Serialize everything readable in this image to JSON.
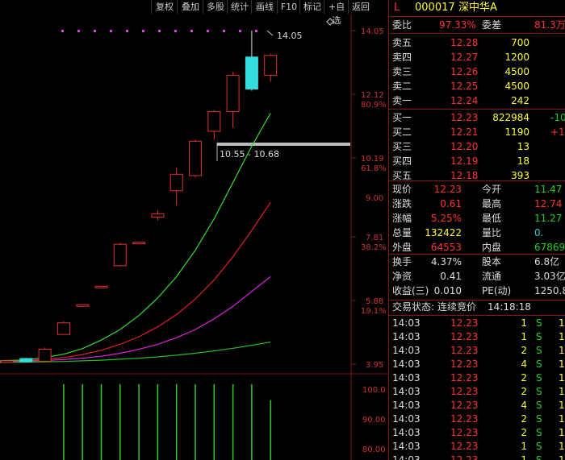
{
  "toolbar": {
    "buttons": [
      "复权",
      "叠加",
      "多股",
      "统计",
      "画线",
      "F10",
      "标记",
      "+自选",
      "返回"
    ]
  },
  "chart": {
    "price_axis": [
      "14.05",
      "12.12",
      "10.19",
      "9.00",
      "7.81",
      "5.88",
      "3.95"
    ],
    "pct_axis": [
      "80.9%",
      "61.8%",
      "38.2%",
      "19.1%"
    ],
    "vol_axis": [
      "100.0",
      "90.00",
      "80.00"
    ],
    "high_marker": "14.05",
    "range_label": "10.55 - 10.68"
  },
  "panel": {
    "code_prefix": "L",
    "stock_code": "000017",
    "stock_name": "深中华A",
    "weibi_label": "委比",
    "weibi_value": "97.33%",
    "weicha_label": "委差",
    "weicha_value": "81.3万",
    "asks": [
      {
        "label": "卖五",
        "price": "12.28",
        "vol": "700"
      },
      {
        "label": "卖四",
        "price": "12.27",
        "vol": "1200"
      },
      {
        "label": "卖三",
        "price": "12.26",
        "vol": "4500"
      },
      {
        "label": "卖二",
        "price": "12.25",
        "vol": "4500"
      },
      {
        "label": "卖一",
        "price": "12.24",
        "vol": "242"
      }
    ],
    "bids": [
      {
        "label": "买一",
        "price": "12.23",
        "vol": "822984",
        "chg": "-10"
      },
      {
        "label": "买二",
        "price": "12.21",
        "vol": "1190",
        "chg": "+1"
      },
      {
        "label": "买三",
        "price": "12.20",
        "vol": "13",
        "chg": ""
      },
      {
        "label": "买四",
        "price": "12.19",
        "vol": "18",
        "chg": ""
      },
      {
        "label": "买五",
        "price": "12.18",
        "vol": "393",
        "chg": ""
      }
    ],
    "stats": [
      {
        "l1": "现价",
        "v1": "12.23",
        "l2": "今开",
        "v2": "11.47"
      },
      {
        "l1": "涨跌",
        "v1": "0.61",
        "l2": "最高",
        "v2": "12.74"
      },
      {
        "l1": "涨幅",
        "v1": "5.25%",
        "l2": "最低",
        "v2": "11.27"
      },
      {
        "l1": "总量",
        "v1": "132422",
        "l2": "量比",
        "v2": "0."
      },
      {
        "l1": "外盘",
        "v1": "64553",
        "l2": "内盘",
        "v2": "67869"
      }
    ],
    "fund": [
      {
        "l1": "换手",
        "v1": "4.37%",
        "l2": "股本",
        "v2": "6.8亿"
      },
      {
        "l1": "净资",
        "v1": "0.41",
        "l2": "流通",
        "v2": "3.03亿"
      },
      {
        "l1": "收益(三)",
        "v1": "0.010",
        "l2": "PE(动)",
        "v2": "1250.8"
      }
    ],
    "status_label": "交易状态:",
    "status_value": "连续竞价",
    "status_time": "14:18:18",
    "ticks": [
      {
        "time": "14:03",
        "price": "12.23",
        "vol": "1",
        "flag": "S",
        "n": "1"
      },
      {
        "time": "14:03",
        "price": "12.23",
        "vol": "1",
        "flag": "S",
        "n": "1"
      },
      {
        "time": "14:03",
        "price": "12.23",
        "vol": "2",
        "flag": "S",
        "n": "1"
      },
      {
        "time": "14:03",
        "price": "12.23",
        "vol": "4",
        "flag": "S",
        "n": "1"
      },
      {
        "time": "14:03",
        "price": "12.23",
        "vol": "2",
        "flag": "S",
        "n": "1"
      },
      {
        "time": "14:03",
        "price": "12.23",
        "vol": "2",
        "flag": "S",
        "n": "1"
      },
      {
        "time": "14:03",
        "price": "12.23",
        "vol": "4",
        "flag": "S",
        "n": "1"
      },
      {
        "time": "14:03",
        "price": "12.23",
        "vol": "2",
        "flag": "S",
        "n": "1"
      },
      {
        "time": "14:03",
        "price": "12.23",
        "vol": "2",
        "flag": "S",
        "n": "1"
      },
      {
        "time": "14:03",
        "price": "12.23",
        "vol": "1",
        "flag": "S",
        "n": "1"
      },
      {
        "time": "14:03",
        "price": "12.23",
        "vol": "1",
        "flag": "S",
        "n": "1"
      }
    ]
  },
  "chart_data": {
    "type": "candlestick",
    "ylim": [
      3.95,
      14.05
    ],
    "candles": [
      {
        "o": 4.02,
        "c": 4.05,
        "h": 4.08,
        "l": 4.0,
        "dir": "up"
      },
      {
        "o": 4.02,
        "c": 4.12,
        "h": 4.14,
        "l": 4.0,
        "dir": "down_fill"
      },
      {
        "o": 4.04,
        "c": 4.4,
        "h": 4.45,
        "l": 4.03,
        "dir": "up"
      },
      {
        "o": 4.85,
        "c": 5.2,
        "h": 5.25,
        "l": 4.85,
        "dir": "up"
      },
      {
        "o": 5.72,
        "c": 5.75,
        "h": 5.76,
        "l": 5.72,
        "dir": "up"
      },
      {
        "o": 6.29,
        "c": 6.31,
        "h": 6.32,
        "l": 6.29,
        "dir": "up"
      },
      {
        "o": 6.93,
        "c": 7.58,
        "h": 7.62,
        "l": 6.9,
        "dir": "up"
      },
      {
        "o": 7.62,
        "c": 7.64,
        "h": 7.65,
        "l": 7.62,
        "dir": "up"
      },
      {
        "o": 8.4,
        "c": 8.5,
        "h": 8.6,
        "l": 8.3,
        "dir": "up"
      },
      {
        "o": 9.2,
        "c": 9.7,
        "h": 9.9,
        "l": 8.75,
        "dir": "up"
      },
      {
        "o": 9.66,
        "c": 10.7,
        "h": 10.75,
        "l": 9.6,
        "dir": "up"
      },
      {
        "o": 11.0,
        "c": 11.6,
        "h": 11.65,
        "l": 10.75,
        "dir": "up"
      },
      {
        "o": 11.6,
        "c": 12.7,
        "h": 12.8,
        "l": 11.1,
        "dir": "up"
      },
      {
        "o": 13.25,
        "c": 12.28,
        "h": 14.05,
        "l": 12.23,
        "dir": "down_fill"
      },
      {
        "o": 12.7,
        "c": 13.3,
        "h": 13.35,
        "l": 12.5,
        "dir": "up"
      }
    ],
    "volumes": [
      0,
      0,
      0,
      100,
      100,
      100,
      100,
      100,
      100,
      100,
      100,
      100,
      100,
      100,
      95
    ],
    "vol_ylim": [
      76,
      101
    ],
    "ma_lines": [
      {
        "color": "#33dd33",
        "values": [
          4.05,
          4.08,
          4.15,
          4.25,
          4.42,
          4.68,
          5.0,
          5.42,
          5.95,
          6.6,
          7.4,
          8.35,
          9.45,
          10.55,
          11.55
        ]
      },
      {
        "color": "#dd2222",
        "values": [
          4.03,
          4.05,
          4.1,
          4.15,
          4.24,
          4.37,
          4.55,
          4.78,
          5.08,
          5.45,
          5.92,
          6.5,
          7.2,
          8.0,
          8.85
        ]
      },
      {
        "color": "#dd22dd",
        "values": [
          4.02,
          4.04,
          4.06,
          4.09,
          4.13,
          4.19,
          4.28,
          4.4,
          4.55,
          4.75,
          5.0,
          5.32,
          5.7,
          6.15,
          6.6
        ]
      },
      {
        "color": "#22bb22",
        "values": [
          4.0,
          4.01,
          4.02,
          4.03,
          4.05,
          4.07,
          4.1,
          4.13,
          4.17,
          4.22,
          4.28,
          4.35,
          4.43,
          4.52,
          4.62
        ]
      }
    ]
  }
}
